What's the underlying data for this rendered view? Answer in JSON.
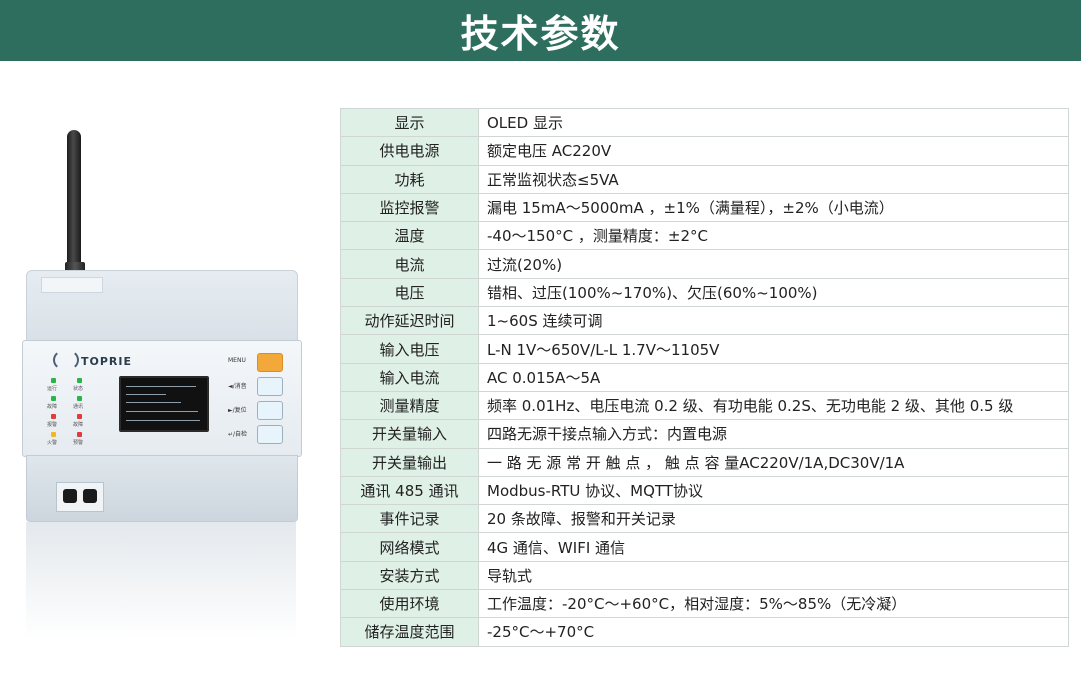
{
  "header": {
    "title": "技术参数"
  },
  "device": {
    "logo_text": "TOPRIE",
    "keys": [
      "MENU",
      "◄/消音",
      "►/复位",
      "↵/自检"
    ],
    "led_labels": [
      "运行",
      "状态",
      "故障",
      "通讯",
      "报警",
      "故障",
      "火警",
      "预警"
    ],
    "colors": {
      "key_menu": "#f3a93a",
      "key_other": "#e8f4fb",
      "led_green": "#2bb44a",
      "led_red": "#e33b3b",
      "led_yellow": "#f2b52b"
    }
  },
  "specs": [
    {
      "label": "显示",
      "value": "OLED 显示"
    },
    {
      "label": "供电电源",
      "value": "额定电压 AC220V"
    },
    {
      "label": "功耗",
      "value": "正常监视状态≤5VA"
    },
    {
      "label": "监控报警",
      "value": "漏电 15mA～5000mA ，±1%（满量程），±2%（小电流）"
    },
    {
      "label": "温度",
      "value": "-40～150°C ，测量精度：±2°C"
    },
    {
      "label": "电流",
      "value": "过流(20%)"
    },
    {
      "label": "电压",
      "value": "错相、过压(100%~170%)、欠压(60%~100%)"
    },
    {
      "label": "动作延迟时间",
      "value": "1~60S 连续可调"
    },
    {
      "label": "输入电压",
      "value": "L-N 1V～650V/L-L 1.7V～1105V"
    },
    {
      "label": "输入电流",
      "value": "AC 0.015A～5A"
    },
    {
      "label": "测量精度",
      "value": "频率 0.01Hz、电压电流 0.2 级、有功电能 0.2S、无功电能 2 级、其他 0.5 级"
    },
    {
      "label": "开关量输入",
      "value": "四路无源干接点输入方式：内置电源"
    },
    {
      "label": "开关量输出",
      "value": "一 路 无 源 常 开 触 点 ， 触 点 容 量AC220V/1A,DC30V/1A"
    },
    {
      "label": "通讯 485 通讯",
      "value": "Modbus-RTU 协议、MQTT协议"
    },
    {
      "label": "事件记录",
      "value": "20 条故障、报警和开关记录"
    },
    {
      "label": "网络模式",
      "value": "4G 通信、WIFI 通信"
    },
    {
      "label": "安装方式",
      "value": "导轨式"
    },
    {
      "label": "使用环境",
      "value": "工作温度：-20°C～+60°C，相对湿度：5%～85%（无冷凝）"
    },
    {
      "label": "储存温度范围",
      "value": " -25°C～+70°C"
    }
  ]
}
